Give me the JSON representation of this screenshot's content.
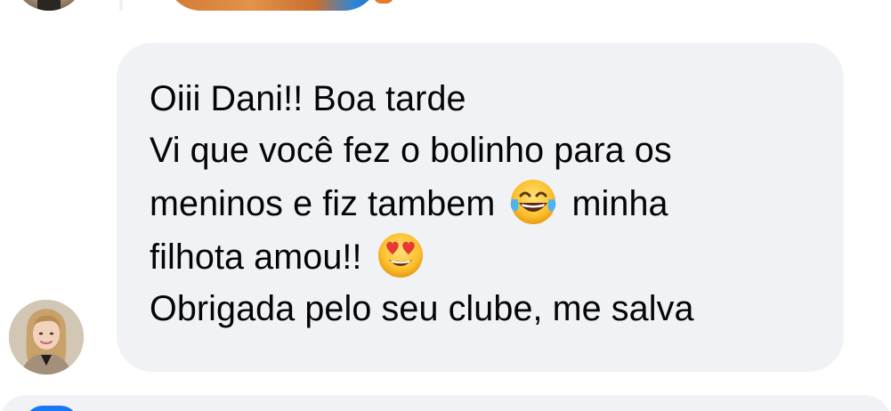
{
  "comment": {
    "lines": {
      "l1": "Oiii Dani!! Boa tarde",
      "l2": "Vi que você fez o bolinho para os",
      "l3a": "meninos e fiz tambem",
      "l3b": "minha",
      "l4": "filhota amou!!",
      "l5": "Obrigada pelo seu clube, me salva"
    },
    "emojis": [
      "face-with-tears-of-joy-icon",
      "smiling-face-with-heart-eyes-icon"
    ],
    "bubble_color": "#f0f2f5",
    "text_color": "#050505"
  }
}
